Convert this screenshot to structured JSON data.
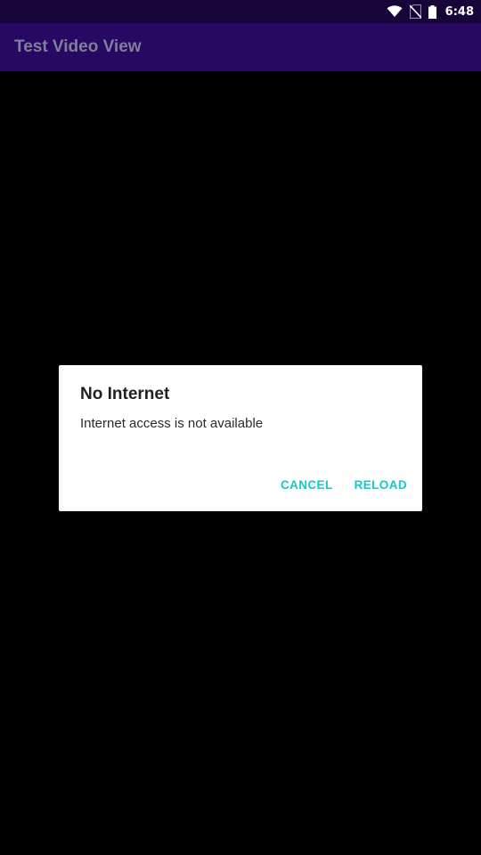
{
  "status_bar": {
    "time": "6:48",
    "icons": [
      "wifi-icon",
      "no-sim-icon",
      "battery-icon"
    ]
  },
  "app_bar": {
    "title": "Test Video View",
    "background_color": "#270862",
    "title_color": "#7f7f99"
  },
  "dialog": {
    "title": "No Internet",
    "message": "Internet access is not available",
    "cancel_label": "CANCEL",
    "reload_label": "RELOAD",
    "button_color": "#14c8c8"
  }
}
